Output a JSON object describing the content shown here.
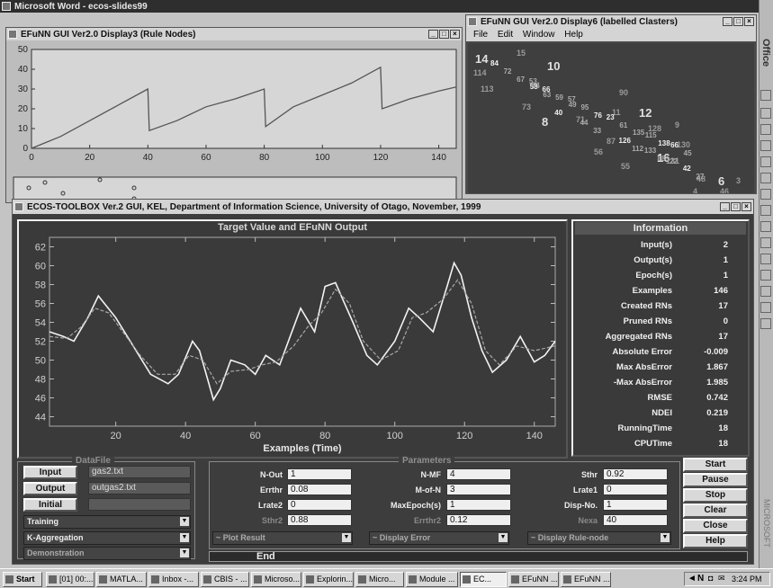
{
  "word_window": {
    "title": "Microsoft Word - ecos-slides99"
  },
  "display3": {
    "title": "EFuNN GUI Ver2.0 Display3 (Rule Nodes)",
    "chart_data": {
      "type": "line",
      "xlim": [
        0,
        146
      ],
      "ylim": [
        0,
        50
      ],
      "xticks": [
        0,
        20,
        40,
        60,
        80,
        100,
        120,
        140
      ],
      "yticks": [
        0,
        10,
        20,
        30,
        40,
        50
      ],
      "series": [
        {
          "x": [
            0,
            5,
            10,
            20,
            30,
            40,
            40.5,
            50,
            60,
            70,
            80,
            80.5,
            90,
            100,
            110,
            120,
            120.5,
            130,
            140,
            146
          ],
          "values": [
            0,
            3,
            6,
            14,
            22,
            30,
            9,
            14,
            21,
            25,
            30,
            11,
            21,
            27,
            33,
            41,
            20,
            25,
            29,
            31
          ]
        }
      ]
    }
  },
  "display6": {
    "title": "EFuNN GUI Ver2.0 Display6 (labelled Clasters)",
    "menu": [
      "File",
      "Edit",
      "Window",
      "Help"
    ],
    "cluster_labels": [
      {
        "t": "14",
        "big": true
      },
      {
        "t": "15",
        "big": false
      },
      {
        "t": "10",
        "big": true
      },
      {
        "t": "114",
        "big": false
      },
      {
        "t": "113",
        "big": false
      },
      {
        "t": "74",
        "big": false
      },
      {
        "t": "73",
        "big": false
      },
      {
        "t": "8",
        "big": true
      },
      {
        "t": "12",
        "big": true
      },
      {
        "t": "11",
        "big": false
      },
      {
        "t": "9",
        "big": false
      },
      {
        "t": "16",
        "big": true
      },
      {
        "t": "55",
        "big": false
      },
      {
        "t": "56",
        "big": false
      },
      {
        "t": "130",
        "big": false
      },
      {
        "t": "131",
        "big": false
      },
      {
        "t": "6",
        "big": true
      },
      {
        "t": "48",
        "big": false
      },
      {
        "t": "46",
        "big": false
      },
      {
        "t": "3",
        "big": false
      },
      {
        "t": "4",
        "big": false
      },
      {
        "t": "90",
        "big": false
      },
      {
        "t": "71",
        "big": false
      },
      {
        "t": "128",
        "big": false
      },
      {
        "t": "87",
        "big": false
      }
    ]
  },
  "ecos": {
    "title": "ECOS-TOOLBOX Ver.2 GUI,  KEL, Department of Information Science, University of Otago,  November, 1999",
    "plot_title": "Target Value and EFuNN Output",
    "chart_data": {
      "type": "line",
      "xlabel": "Examples (Time)",
      "xlim": [
        1,
        146
      ],
      "ylim": [
        43,
        63
      ],
      "xticks": [
        20,
        40,
        60,
        80,
        100,
        120,
        140
      ],
      "yticks": [
        44,
        46,
        48,
        50,
        52,
        54,
        56,
        58,
        60,
        62
      ],
      "series": [
        {
          "x": [
            1,
            5,
            8,
            12,
            15,
            20,
            25,
            30,
            35,
            38,
            42,
            44,
            48,
            50,
            53,
            57,
            60,
            63,
            67,
            70,
            73,
            77,
            80,
            83,
            85,
            88,
            92,
            95,
            100,
            104,
            107,
            111,
            115,
            117,
            119,
            122,
            125,
            128,
            132,
            136,
            140,
            143,
            146
          ],
          "values": [
            53,
            52.5,
            52,
            54.5,
            56.8,
            54.5,
            51.5,
            48.5,
            47.5,
            48.5,
            52,
            51,
            45.8,
            47,
            50,
            49.5,
            48.5,
            50.5,
            49.5,
            52.5,
            55.5,
            53,
            57.8,
            58.2,
            56.5,
            54,
            50.5,
            49.5,
            52,
            55.5,
            54.5,
            53,
            57.8,
            60.3,
            59,
            54.5,
            51,
            48.7,
            50,
            52.5,
            49.8,
            50.5,
            52
          ]
        },
        {
          "x": [
            1,
            6,
            10,
            14,
            18,
            22,
            27,
            32,
            37,
            41,
            45,
            49,
            53,
            58,
            62,
            66,
            71,
            75,
            79,
            83,
            87,
            91,
            96,
            101,
            105,
            109,
            114,
            118,
            122,
            126,
            130,
            135,
            140,
            146
          ],
          "values": [
            52.5,
            52.3,
            53.5,
            55.5,
            55,
            53,
            50.5,
            48.5,
            48.5,
            50.5,
            50,
            47.5,
            48.8,
            49,
            49.5,
            49.8,
            51.5,
            53.5,
            55,
            57.5,
            56,
            52,
            50,
            51,
            54.5,
            55,
            56.5,
            58.5,
            56,
            51,
            49.5,
            51.5,
            51,
            51.5
          ]
        }
      ]
    },
    "info": {
      "header": "Information",
      "rows": [
        {
          "label": "Input(s)",
          "value": "2"
        },
        {
          "label": "Output(s)",
          "value": "1"
        },
        {
          "label": "Epoch(s)",
          "value": "1"
        },
        {
          "label": "Examples",
          "value": "146"
        },
        {
          "label": "Created RNs",
          "value": "17"
        },
        {
          "label": "Pruned RNs",
          "value": "0"
        },
        {
          "label": "Aggregated RNs",
          "value": "17"
        },
        {
          "label": "Absolute Error",
          "value": "-0.009"
        },
        {
          "label": "Max AbsError",
          "value": "1.867"
        },
        {
          "label": "-Max AbsError",
          "value": "1.985"
        },
        {
          "label": "RMSE",
          "value": "0.742"
        },
        {
          "label": "NDEI",
          "value": "0.219"
        },
        {
          "label": "RunningTime",
          "value": "18"
        },
        {
          "label": "CPUTime",
          "value": "18"
        }
      ]
    },
    "datafile": {
      "header": "DataFile",
      "input_label": "Input",
      "input_value": "gas2.txt",
      "output_label": "Output",
      "output_value": "outgas2.txt",
      "initial_label": "Initial",
      "initial_value": "",
      "mode": "Training",
      "method": "K-Aggregation",
      "demo": "Demonstration"
    },
    "params": {
      "header": "Parameters",
      "nout_label": "N-Out",
      "nout": "1",
      "errthr_label": "Errthr",
      "errthr": "0.08",
      "lrate2_label": "Lrate2",
      "lrate2": "0",
      "sthr2_label": "Sthr2",
      "sthr2": "0.88",
      "nmf_label": "N-MF",
      "nmf": "4",
      "mofn_label": "M-of-N",
      "mofn": "3",
      "maxepoch_label": "MaxEpoch(s)",
      "maxepoch": "1",
      "errthr2_label": "Errthr2",
      "errthr2": "0.12",
      "sthr_label": "Sthr",
      "sthr": "0.92",
      "lrate1_label": "Lrate1",
      "lrate1": "0",
      "dispno_label": "Disp-No.",
      "dispno": "1",
      "nexa_label": "Nexa",
      "nexa": "40",
      "plot_result": "~ Plot Result",
      "display_error": "~ Display Error",
      "display_rule": "~ Display Rule-node"
    },
    "buttons": [
      "Start",
      "Pause",
      "Stop",
      "Clear",
      "Close",
      "Help"
    ],
    "status": "End"
  },
  "right_bar": {
    "office_label": "Office",
    "microsoft_label": "MICROSOFT"
  },
  "taskbar": {
    "start": "Start",
    "items": [
      {
        "label": "[01] 00:...",
        "active": false
      },
      {
        "label": "MATLA...",
        "active": false
      },
      {
        "label": "Inbox -...",
        "active": false
      },
      {
        "label": "CBIS - ...",
        "active": false
      },
      {
        "label": "Microso...",
        "active": false
      },
      {
        "label": "Explorin...",
        "active": false
      },
      {
        "label": "Micro...",
        "active": false
      },
      {
        "label": "Module ...",
        "active": false
      },
      {
        "label": "EC...",
        "active": true
      },
      {
        "label": "EFuNN ...",
        "active": false
      },
      {
        "label": "EFuNN ...",
        "active": false
      }
    ],
    "clock": "3:24 PM"
  }
}
